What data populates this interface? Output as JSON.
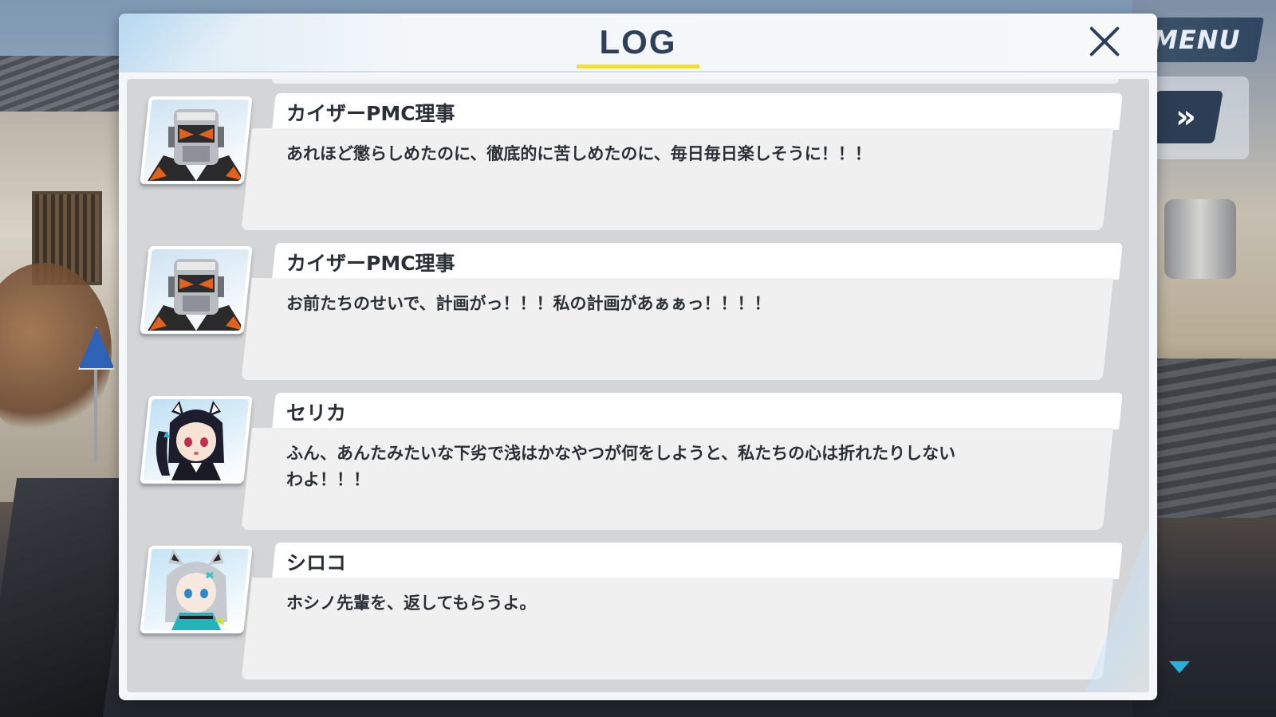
{
  "hud": {
    "menu_label": "MENU",
    "fast_forward_label": "»"
  },
  "log": {
    "title": "LOG",
    "entries": [
      {
        "speaker": "カイザーPMC理事",
        "avatar": "kaiser-pmc-director-portrait",
        "text": "あれほど懲らしめたのに、徹底的に苦しめたのに、毎日毎日楽しそうに！！！"
      },
      {
        "speaker": "カイザーPMC理事",
        "avatar": "kaiser-pmc-director-portrait",
        "text": "お前たちのせいで、計画がっ！！！私の計画があぁぁっ！！！！"
      },
      {
        "speaker": "セリカ",
        "avatar": "serika-portrait",
        "text": "ふん、あんたみたいな下劣で浅はかなやつが何をしようと、私たちの心は折れたりしないわよ！！！"
      },
      {
        "speaker": "シロコ",
        "avatar": "shiroko-portrait",
        "text": "ホシノ先輩を、返してもらうよ。"
      }
    ]
  },
  "colors": {
    "title_text": "#2d4058",
    "title_underline": "#f3e02c",
    "scroll_indicator": "#2ab0d8"
  }
}
